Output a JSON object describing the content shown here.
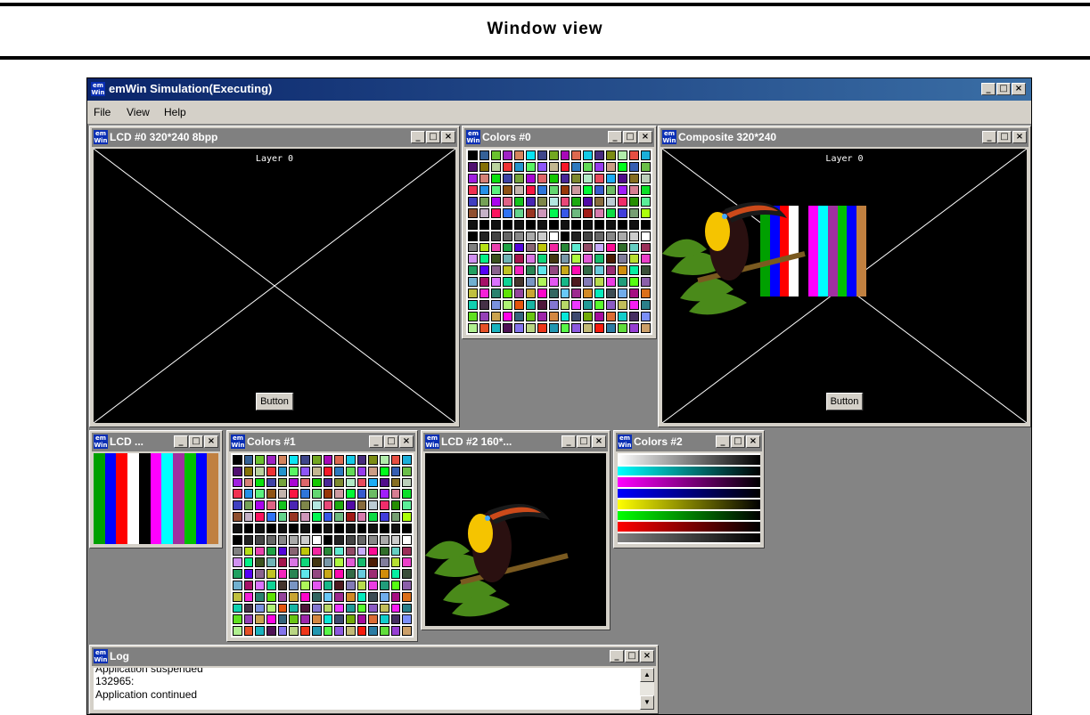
{
  "page_title": "Window view",
  "app": {
    "title": "emWin Simulation(Executing)",
    "icon_text": "em\nWin",
    "menu": [
      "File",
      "View",
      "Help"
    ],
    "controls": {
      "minimize": "_",
      "maximize": "□",
      "close": "×"
    }
  },
  "windows": {
    "lcd0": {
      "title": "LCD #0 320*240 8bpp",
      "layer_label": "Layer 0",
      "button": "Button"
    },
    "colors0": {
      "title": "Colors #0"
    },
    "composite": {
      "title": "Composite 320*240",
      "layer_label": "Layer 0",
      "button": "Button"
    },
    "lcd1": {
      "title": "LCD ..."
    },
    "colors1": {
      "title": "Colors #1"
    },
    "lcd2": {
      "title": "LCD #2 160*..."
    },
    "colors2": {
      "title": "Colors #2"
    },
    "log": {
      "title": "Log",
      "lines": [
        "Application suspended",
        "132965:",
        "Application continued"
      ]
    }
  },
  "colors": {
    "bars": [
      "#00a000",
      "#0000ff",
      "#ff0000",
      "#ffffff",
      "#000000",
      "#ff00ff",
      "#00ffff",
      "#a030a0",
      "#00c000",
      "#0000ff",
      "#c08040"
    ],
    "gradients": [
      "#ffffff",
      "#00ffff",
      "#ff00ff",
      "#0000ff",
      "#ffff00",
      "#00ff00",
      "#ff0000",
      "#808080"
    ]
  }
}
